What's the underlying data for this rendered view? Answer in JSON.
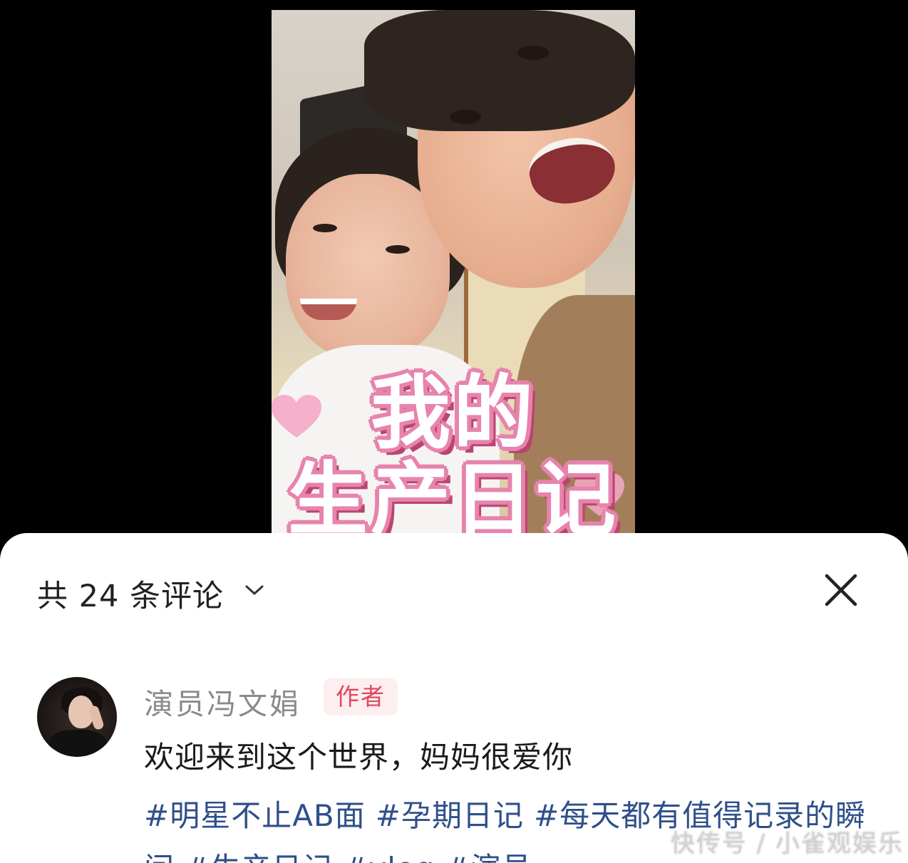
{
  "video": {
    "overlay_line1": "我的",
    "overlay_line2": "生产日记",
    "accent_color": "#e783ad"
  },
  "comments_panel": {
    "header_title": "共 24 条评论",
    "expand_icon": "chevron-down-icon",
    "close_icon": "close-icon",
    "comment": {
      "username": "演员冯文娟",
      "badge": "作者",
      "text": "欢迎来到这个世界，妈妈很爱你",
      "hashtags": [
        "#明星不止AB面",
        "#孕期日记",
        "#每天都有值得记录的瞬间",
        "#生产日记",
        "#vlog",
        "#演员"
      ]
    }
  },
  "watermark": "快传号 / 小雀观娱乐",
  "colors": {
    "badge_text": "#e0465e",
    "badge_bg": "#fdeef0",
    "hashtag": "#2f4f8a"
  }
}
